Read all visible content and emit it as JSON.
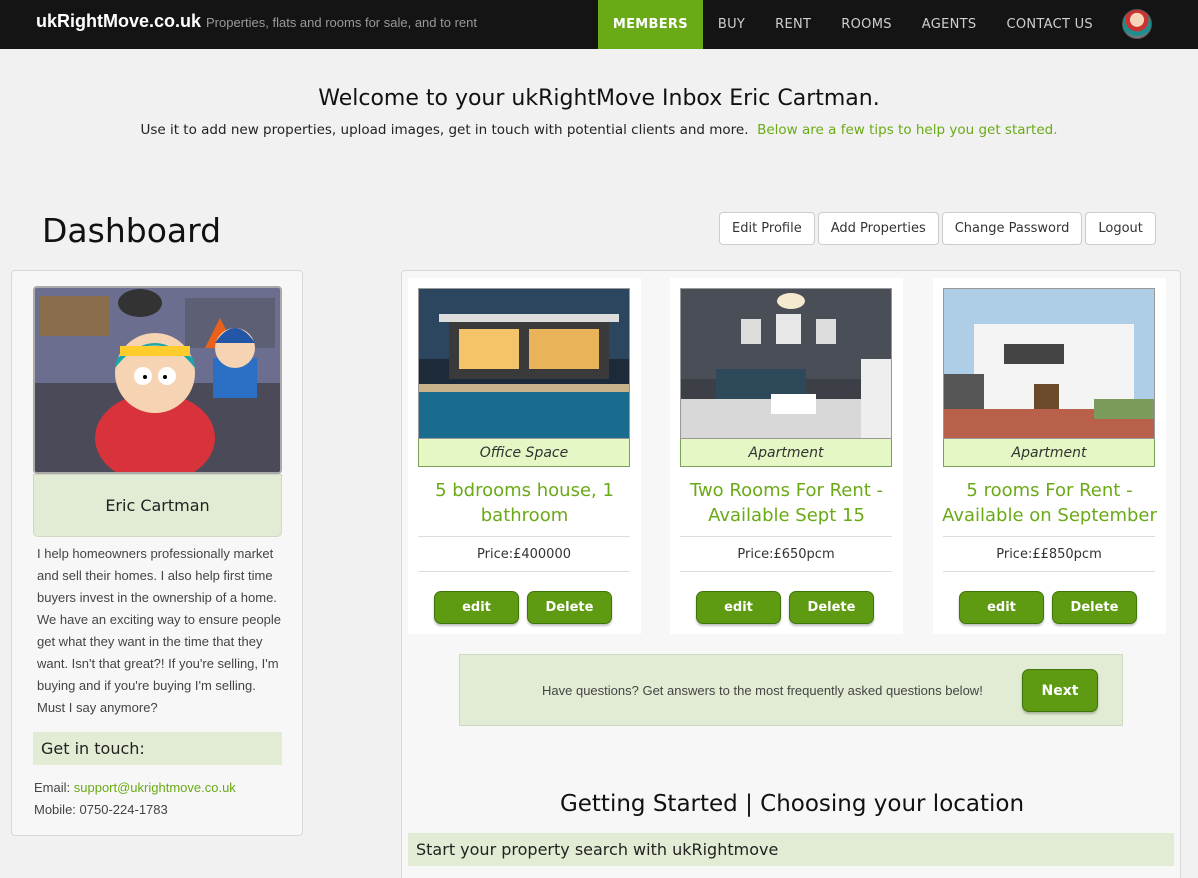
{
  "navbar": {
    "brand": "ukRightMove.co.uk",
    "tagline": "Properties, flats and rooms for sale, and to rent",
    "items": [
      "MEMBERS",
      "BUY",
      "RENT",
      "ROOMS",
      "AGENTS",
      "CONTACT US"
    ],
    "active": "MEMBERS"
  },
  "welcome": {
    "title": "Welcome to your ukRightMove Inbox Eric Cartman.",
    "subtitle": "Use it to add new properties, upload images, get in touch with potential clients and more.",
    "tip": "Below are a few tips to help you get started."
  },
  "dashboard": {
    "title": "Dashboard",
    "buttons": [
      "Edit Profile",
      "Add Properties",
      "Change Password",
      "Logout"
    ]
  },
  "profile": {
    "name": "Eric Cartman",
    "bio": "I help homeowners professionally market and sell their homes. I also help first time buyers invest in the ownership of a home. We have an exciting way to ensure people get what they want in the time that they want. Isn't that great?! If you're selling, I'm buying and if you're buying I'm selling. Must I say anymore?",
    "get_in_touch": "Get in touch:",
    "email_label": "Email:",
    "email": "support@ukrightmove.co.uk",
    "mobile_label": "Mobile:",
    "mobile": "0750-224-1783"
  },
  "listings": [
    {
      "type": "Office Space",
      "title": "5 bdrooms house, 1 bathroom",
      "price": "Price:£400000",
      "edit": "edit",
      "delete": "Delete"
    },
    {
      "type": "Apartment",
      "title": "Two Rooms For Rent - Available Sept 15",
      "price": "Price:£650pcm",
      "edit": "edit",
      "delete": "Delete"
    },
    {
      "type": "Apartment",
      "title": "5 rooms For Rent - Available on September",
      "price": "Price:££850pcm",
      "edit": "edit",
      "delete": "Delete"
    }
  ],
  "faq": {
    "text": "Have questions? Get answers to the most frequently asked questions below!",
    "next": "Next"
  },
  "getting_started": {
    "title": "Getting Started | Choosing your location",
    "bar": "Start your property search with ukRightmove"
  },
  "colors": {
    "accent": "#6aaa17",
    "nav_bg": "#141414",
    "panel_green": "#e2ecd4",
    "type_green": "#e4f7c4"
  }
}
